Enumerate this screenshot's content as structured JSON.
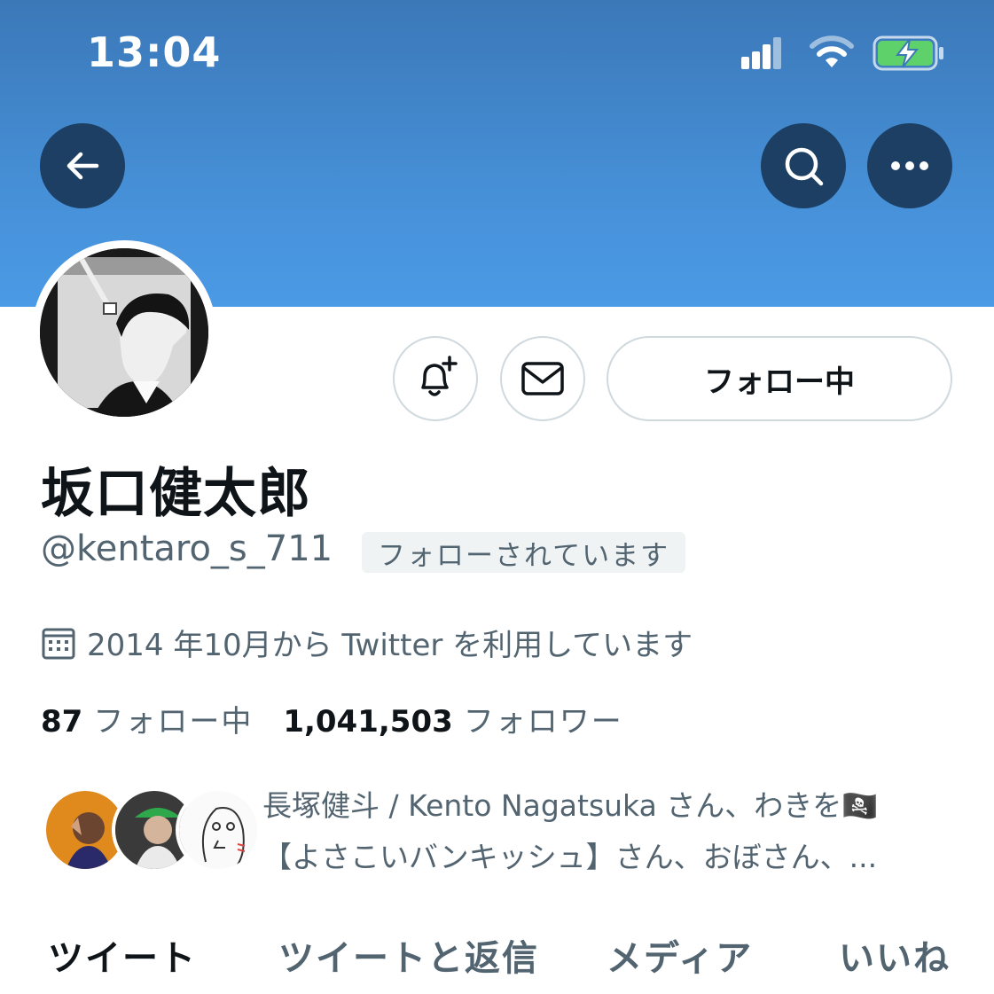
{
  "status_bar": {
    "time": "13:04"
  },
  "colors": {
    "banner": "#468fd6",
    "nav_button": "#1c3f63",
    "muted_text": "#536471",
    "battery_fill": "#5fd16a"
  },
  "header": {
    "back_icon": "arrow-left-icon",
    "search_icon": "search-icon",
    "more_icon": "more-horizontal-icon"
  },
  "profile": {
    "display_name": "坂口健太郎",
    "handle": "@kentaro_s_711",
    "follows_you_badge": "フォローされています",
    "joined": "2014 年10月から Twitter を利用しています",
    "following_count": "87",
    "following_label": "フォロー中",
    "followers_count": "1,041,503",
    "followers_label": "フォロワー"
  },
  "actions": {
    "notify_icon": "bell-plus-icon",
    "message_icon": "envelope-icon",
    "follow_label": "フォロー中"
  },
  "followers_you_know": {
    "line1": "長塚健斗 / Kento Nagatsuka さん、わきを🏴‍☠️",
    "line2": "【よさこいバンキッシュ】さん、おぼさん、..."
  },
  "tabs": [
    {
      "label": "ツイート",
      "active": true
    },
    {
      "label": "ツイートと返信",
      "active": false
    },
    {
      "label": "メディア",
      "active": false
    },
    {
      "label": "いいね",
      "active": false
    }
  ]
}
